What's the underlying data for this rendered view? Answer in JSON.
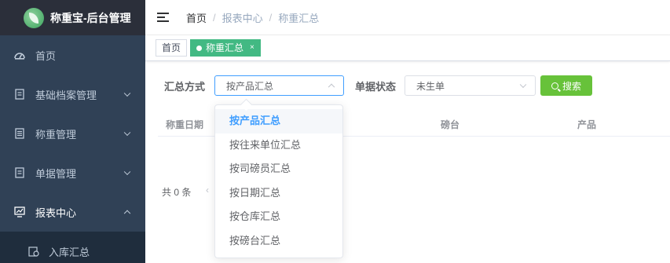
{
  "app": {
    "title": "称重宝-后台管理"
  },
  "sidebar": {
    "items": [
      {
        "label": "首页",
        "icon": "dashboard-icon"
      },
      {
        "label": "基础档案管理",
        "icon": "document-icon"
      },
      {
        "label": "称重管理",
        "icon": "list-icon"
      },
      {
        "label": "单据管理",
        "icon": "document-icon"
      },
      {
        "label": "报表中心",
        "icon": "chart-icon"
      }
    ],
    "subitems": [
      {
        "label": "入库汇总",
        "icon": "report-icon"
      }
    ]
  },
  "breadcrumb": {
    "home": "首页",
    "section": "报表中心",
    "page": "称重汇总",
    "separator": "/"
  },
  "tags": {
    "home": "首页",
    "active": "称重汇总",
    "close": "×"
  },
  "form": {
    "summary_label": "汇总方式",
    "summary_value": "按产品汇总",
    "status_label": "单据状态",
    "status_value": "未生单",
    "search_label": "搜索"
  },
  "dropdown": {
    "options": [
      "按产品汇总",
      "按往来单位汇总",
      "按司磅员汇总",
      "按日期汇总",
      "按仓库汇总",
      "按磅台汇总"
    ]
  },
  "table": {
    "columns": [
      "称重日期",
      "磅台",
      "产品"
    ]
  },
  "pagination": {
    "total": "共 0 条",
    "prev": "‹"
  },
  "colors": {
    "sidebar": "#304156",
    "accent": "#409eff",
    "tag_active": "#42b983",
    "search_button": "#67c23a"
  }
}
